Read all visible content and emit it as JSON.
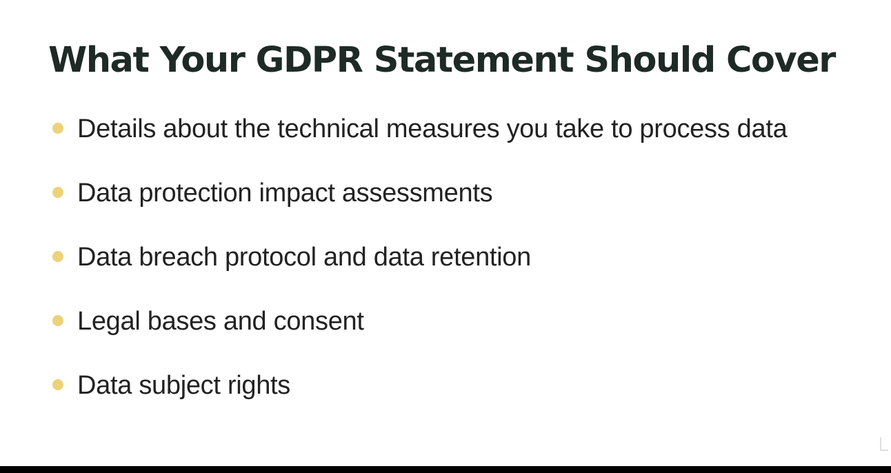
{
  "slide": {
    "title": "What Your GDPR Statement Should Cover",
    "bullets": [
      "Details about the technical measures you take to process data",
      "Data protection impact assessments",
      "Data breach protocol and data retention",
      "Legal bases and consent",
      "Data subject rights"
    ]
  },
  "colors": {
    "background": "#ffffff",
    "title": "#1e2a25",
    "text": "#222222",
    "bullet_dot": "#ecd27a",
    "letterbox": "#000000"
  },
  "icons": {
    "corner_mark": "logo-watermark-icon"
  }
}
